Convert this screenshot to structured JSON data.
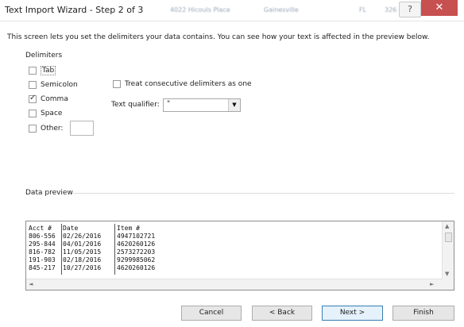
{
  "window": {
    "title": "Text Import Wizard - Step 2 of 3",
    "background_title_fragments": [
      "4022 Hicouls Place",
      "Gainesville",
      "FL",
      "326"
    ],
    "help_glyph": "?",
    "close_glyph": "✕",
    "close_color": "#c75050"
  },
  "description": "This screen lets you set the delimiters your data contains.  You can see how your text is affected in the preview below.",
  "delimiters": {
    "group_label": "Delimiters",
    "options": [
      {
        "label": "Tab",
        "checked": false
      },
      {
        "label": "Semicolon",
        "checked": false
      },
      {
        "label": "Comma",
        "checked": true
      },
      {
        "label": "Space",
        "checked": false
      },
      {
        "label": "Other:",
        "checked": false
      }
    ],
    "other_value": ""
  },
  "consecutive": {
    "label": "Treat consecutive delimiters as one",
    "checked": false
  },
  "qualifier": {
    "label": "Text qualifier:",
    "value": "\""
  },
  "preview": {
    "group_label": "Data preview",
    "headers": [
      "Acct #",
      "Date",
      "Item #"
    ],
    "rows": [
      [
        "806-556",
        "02/26/2016",
        "4947102721"
      ],
      [
        "295-844",
        "04/01/2016",
        "4620260126"
      ],
      [
        "816-782",
        "11/05/2015",
        "2573272203"
      ],
      [
        "191-903",
        "02/18/2016",
        "9299985062"
      ],
      [
        "845-217",
        "10/27/2016",
        "4620260126"
      ]
    ]
  },
  "buttons": {
    "cancel": "Cancel",
    "back": "< Back",
    "next": "Next >",
    "finish": "Finish"
  },
  "colors": {
    "default_button_border": "#3c7fb1"
  }
}
